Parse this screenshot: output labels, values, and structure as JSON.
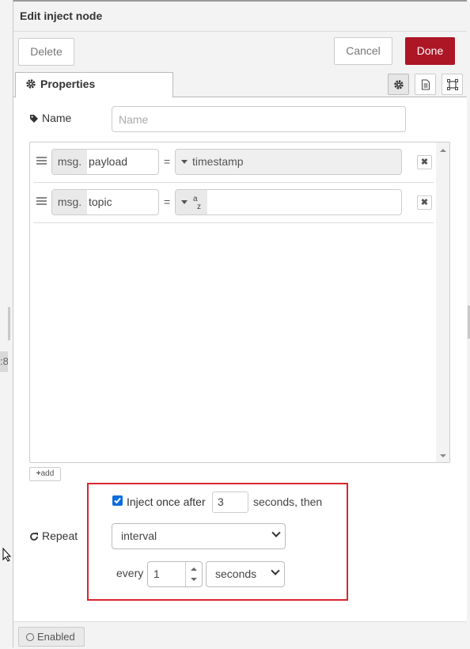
{
  "edge_fragment": ":8",
  "title": "Edit inject node",
  "toolbar": {
    "delete_label": "Delete",
    "cancel_label": "Cancel",
    "done_label": "Done",
    "done_color": "#ad1625"
  },
  "tabs": {
    "properties_label": "Properties"
  },
  "name_field": {
    "label": "Name",
    "placeholder": "Name",
    "value": ""
  },
  "properties": [
    {
      "prefix": "msg.",
      "property": "payload",
      "operator": "=",
      "value_type": "timestamp",
      "value": "timestamp"
    },
    {
      "prefix": "msg.",
      "property": "topic",
      "operator": "=",
      "value_type": "string",
      "value": ""
    }
  ],
  "add_label": "add",
  "inject_once": {
    "checked": true,
    "label": "Inject once after",
    "delay": "3",
    "suffix": "seconds, then"
  },
  "repeat": {
    "label": "Repeat",
    "mode": "interval",
    "every_label": "every",
    "every_value": "1",
    "units": "seconds"
  },
  "footer": {
    "enabled_label": "Enabled"
  },
  "colors": {
    "highlight": "#d9252d",
    "checkbox": "#0a6ddc"
  }
}
